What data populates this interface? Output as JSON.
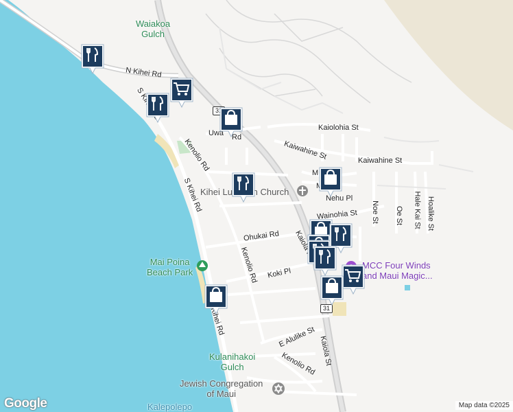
{
  "map": {
    "colors": {
      "water": "#7dd0e4",
      "land": "#f5f4f2",
      "road": "#ffffff",
      "highway": "#d2d2d2",
      "park": "#c8e6c9",
      "marker": "#1d3c5e"
    },
    "places": {
      "waiakoa_gulch": "Waiakoa\nGulch",
      "mai_poina": "Mai Poina\nBeach Park",
      "kulanihakoi": "Kulanihakoi\nGulch",
      "jewish": "Jewish Congregation\nof Maui",
      "kihei_church": "Kihei Lutheran Church",
      "mcc": "MCC Four Winds\nand Maui Magic...",
      "kalepolepo": "Kalepolepo"
    },
    "streets": {
      "n_kihei": "N Kihei Rd",
      "s_kihei_1": "S Kihei Rd",
      "s_kihei_2": "S Kihei Rd",
      "s_kihei_3": "Kihei Rd",
      "uwa": "Uwa",
      "uwa_rd": "Rd",
      "kenolio_1": "Kenolio Rd",
      "kenolio_2": "Kenolio Rd",
      "kenolio_3": "Kenolio Rd",
      "kaiolohia": "Kaiolohia St",
      "kaiwahine_1": "Kaiwahine St",
      "kaiwahine_2": "Kaiwahine St",
      "ma": "M",
      "mi": "M",
      "nehu": "Nehu Pl",
      "wainohia": "Wainohia St",
      "ohukai": "Ohukai Rd",
      "kaiola_pl": "Kaiola Pl",
      "koki": "Koki Pl",
      "noe": "Noe St",
      "oe": "Oe St",
      "hale_kai": "Hale Kai St",
      "hoalike": "Hoalike St",
      "e_alulike": "E Alulike St",
      "kaiola_st": "Kaiola St",
      "route_31a": "31",
      "route_31b": "31"
    },
    "attribution": "Map data ©2025",
    "logo": "Google",
    "markers": [
      {
        "type": "restaurant",
        "icon": "fork-knife-icon"
      },
      {
        "type": "restaurant",
        "icon": "fork-knife-icon"
      },
      {
        "type": "grocery",
        "icon": "shopping-cart-icon"
      },
      {
        "type": "shopping",
        "icon": "shopping-bag-icon"
      },
      {
        "type": "restaurant",
        "icon": "fork-knife-icon"
      },
      {
        "type": "shopping",
        "icon": "shopping-bag-icon"
      },
      {
        "type": "shopping",
        "icon": "shopping-bag-icon"
      },
      {
        "type": "shopping",
        "icon": "shopping-bag-icon"
      },
      {
        "type": "restaurant",
        "icon": "fork-knife-icon"
      },
      {
        "type": "shopping",
        "icon": "shopping-bag-icon"
      },
      {
        "type": "restaurant",
        "icon": "fork-knife-icon"
      },
      {
        "type": "restaurant",
        "icon": "fork-knife-icon"
      },
      {
        "type": "grocery",
        "icon": "shopping-cart-icon"
      },
      {
        "type": "shopping",
        "icon": "shopping-bag-icon"
      }
    ]
  }
}
